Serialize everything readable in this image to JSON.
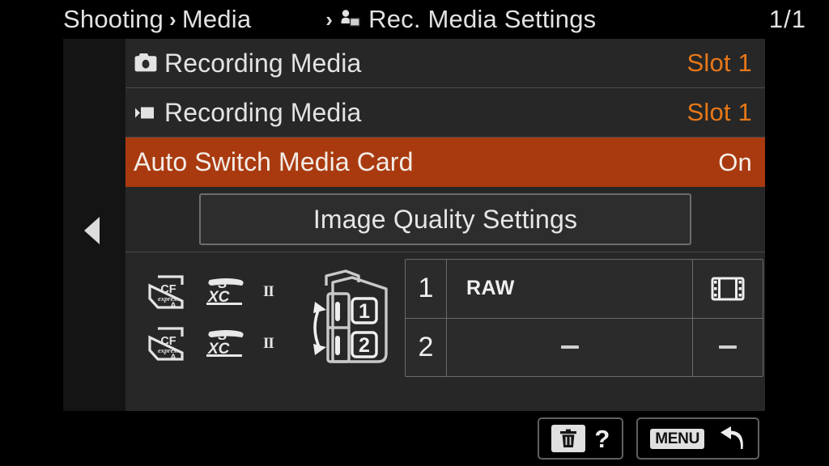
{
  "header": {
    "breadcrumb": [
      {
        "label": "Shooting",
        "icon": null
      },
      {
        "label": "Media",
        "icon": null
      },
      {
        "label": "Rec. Media Settings",
        "icon": "rec-media-settings-icon"
      }
    ],
    "separator": "›",
    "page_indicator": "1/1"
  },
  "colors": {
    "highlight": "#a93a0f",
    "value_orange": "#e87818",
    "panel_bg": "#272727",
    "gutter_bg": "#141414",
    "text": "#e3e3e3",
    "divider": "#4a4a4a"
  },
  "nav": {
    "prev_page_caret": "left-caret-icon"
  },
  "menu": {
    "rows": [
      {
        "icon": "still-camera-icon",
        "label": "Recording Media",
        "value": "Slot 1",
        "selected": false
      },
      {
        "icon": "movie-camera-icon",
        "label": "Recording Media",
        "value": "Slot 1",
        "selected": false
      },
      {
        "icon": null,
        "label": "Auto Switch Media Card",
        "value": "On",
        "selected": true
      }
    ],
    "button": {
      "label": "Image Quality Settings"
    }
  },
  "info": {
    "card_rows": [
      {
        "cfexpress": "CFexpress Type A",
        "sd": "SDXC",
        "speed_class": "II"
      },
      {
        "cfexpress": "CFexpress Type A",
        "sd": "SDXC",
        "speed_class": "II"
      }
    ],
    "diagram": {
      "slot_labels": [
        "1",
        "2"
      ],
      "icon": "camera-slots-diagram-icon"
    },
    "table": {
      "rows": [
        {
          "slot": "1",
          "format": "RAW",
          "movie": "film-strip-icon",
          "movie_text": ""
        },
        {
          "slot": "2",
          "format": "–",
          "movie": null,
          "movie_text": "–"
        }
      ]
    }
  },
  "footer": {
    "buttons": [
      {
        "name": "help-button",
        "icon": "trash-icon",
        "label": "?"
      },
      {
        "name": "menu-back-button",
        "icon": "back-arrow-icon",
        "label": "MENU"
      }
    ]
  }
}
